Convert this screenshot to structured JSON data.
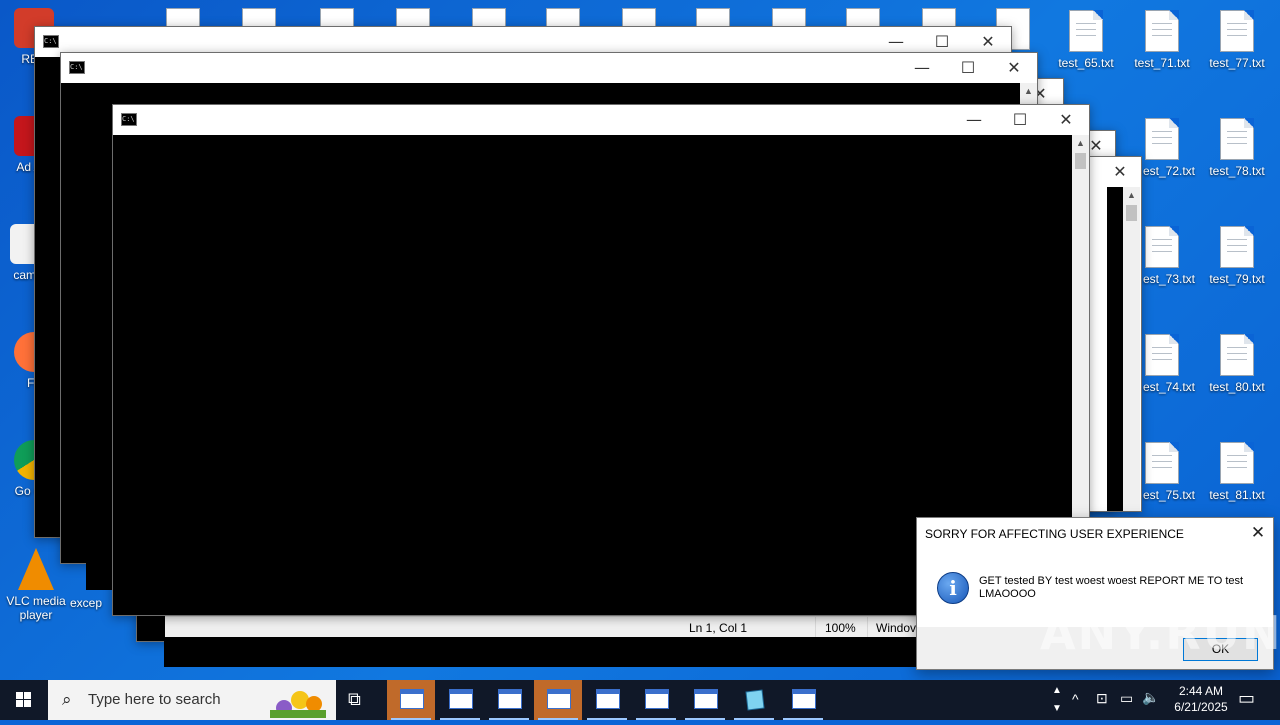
{
  "desktop": {
    "left_shortcuts": [
      {
        "label": "Recycle",
        "color": "#d23c2a"
      },
      {
        "label": "Adobe Acrobat",
        "color": "#c4161c"
      },
      {
        "label": "camera",
        "color": "#e6e6e6"
      },
      {
        "label": "Firefox",
        "color": "#ff7139"
      },
      {
        "label": "Google Chrome",
        "color": "#2ea44f"
      },
      {
        "label": "VLC media player",
        "color": "#f08c00"
      }
    ],
    "visible_left_labels": [
      "REC",
      "Ad Acr",
      "camer",
      "Fir",
      "Go Chr",
      "VLC media player",
      "excep"
    ],
    "files": [
      {
        "label": "test_65.txt"
      },
      {
        "label": "test_71.txt"
      },
      {
        "label": "test_77.txt"
      },
      {
        "label": "est_72.txt"
      },
      {
        "label": "test_78.txt"
      },
      {
        "label": "est_73.txt"
      },
      {
        "label": "test_79.txt"
      },
      {
        "label": "est_74.txt"
      },
      {
        "label": "test_80.txt"
      },
      {
        "label": "est_75.txt"
      },
      {
        "label": "test_81.txt"
      }
    ]
  },
  "windows": {
    "close_glyph": "✕",
    "min_glyph": "—",
    "max_glyph": "☐",
    "cmd_icon_text": "C:\\"
  },
  "notepad_status": {
    "position": "Ln 1, Col 1",
    "zoom": "100%",
    "encoding": "Windov"
  },
  "messagebox": {
    "title": "SORRY FOR AFFECTING USER EXPERIENCE",
    "text": "GET tested BY test woest woest REPORT ME TO test LMAOOOO",
    "icon": "info-icon",
    "info_glyph": "i",
    "ok_label": "OK",
    "close_glyph": "✕"
  },
  "watermark": "ANY.RUN",
  "taskbar": {
    "search_placeholder": "Type here to search",
    "search_glyph": "⌕",
    "taskview_glyph": "⧉",
    "apps": [
      {
        "name": "cmd",
        "active": true
      },
      {
        "name": "cmd",
        "active": false
      },
      {
        "name": "cmd",
        "active": false
      },
      {
        "name": "cmd",
        "active": true
      },
      {
        "name": "cmd",
        "active": false
      },
      {
        "name": "cmd",
        "active": false
      },
      {
        "name": "cmd",
        "active": false
      },
      {
        "name": "notepad",
        "active": false
      },
      {
        "name": "cmd",
        "active": false
      }
    ],
    "tray_chevron": "^",
    "time": "2:44 AM",
    "date": "6/21/2025"
  }
}
